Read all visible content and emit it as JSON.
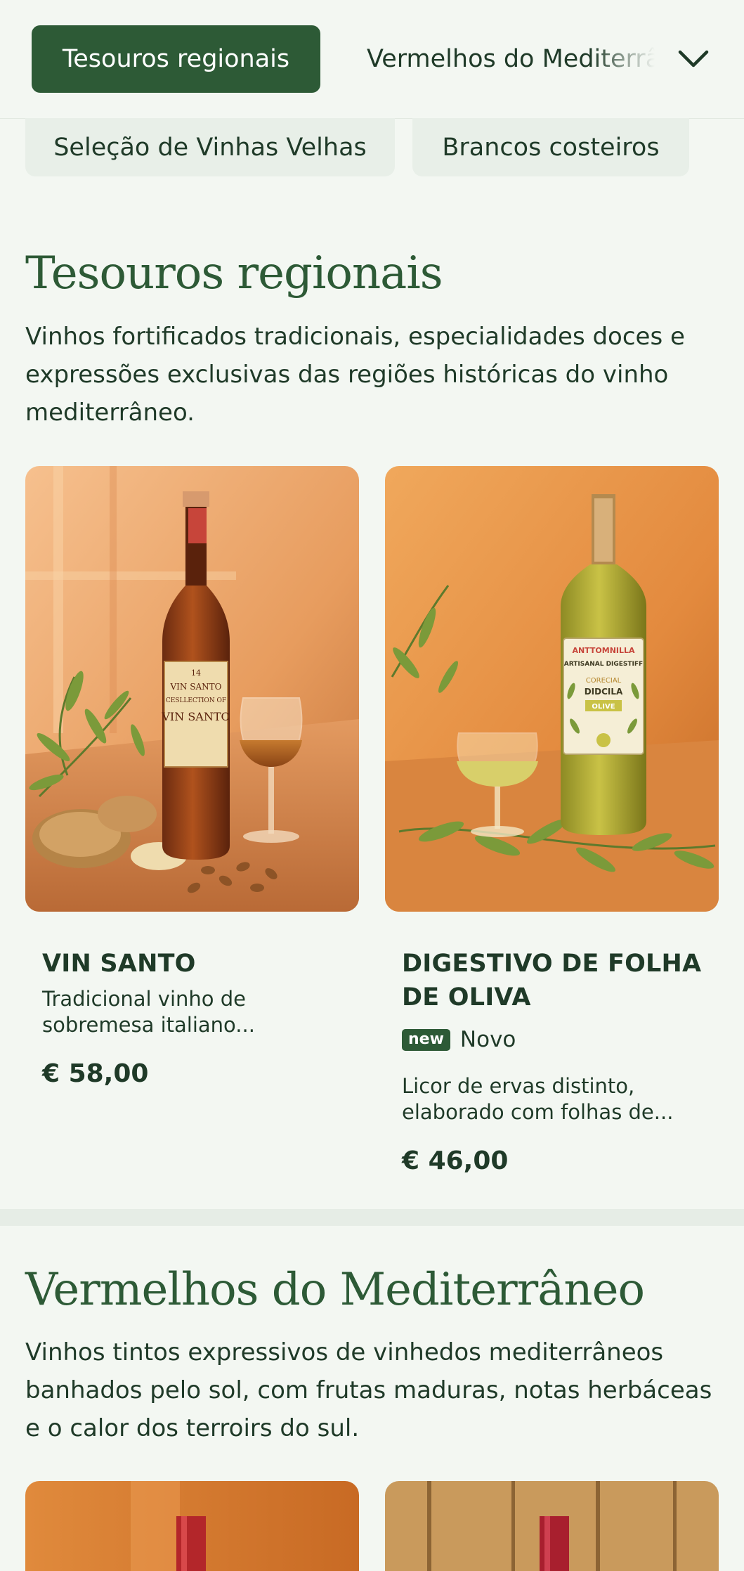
{
  "nav": {
    "active_tab": "Tesouros regionais",
    "next_tab": "Vermelhos do Mediterrâneo",
    "chevron_icon": "chevron-down-icon",
    "sub_tabs": [
      "Seleção de Vinhas Velhas",
      "Brancos costeiros"
    ]
  },
  "sections": [
    {
      "title": "Tesouros regionais",
      "description": "Vinhos fortificados tradicionais, especialidades doces e expressões exclusivas das regiões históricas do vinho mediterrâneo.",
      "products": [
        {
          "name": "VIN SANTO",
          "subtitle": "Tradicional vinho de sobremesa italiano...",
          "price": "€ 58,00",
          "label_lines": [
            "14",
            "VIN SANTO",
            "CESLLECTION OF",
            "VIN SANTO"
          ]
        },
        {
          "name": "DIGESTIVO DE FOLHA DE OLIVA",
          "badge": "new",
          "badge_label": "Novo",
          "subtitle": "Licor de ervas distinto, elaborado com folhas de...",
          "price": "€ 46,00",
          "label_lines": [
            "ANTTOMNILLA",
            "ARTISANAL DIGESTIFF",
            "CORECIAL",
            "DIDCILA",
            "OLIVE"
          ]
        }
      ]
    },
    {
      "title": "Vermelhos do Mediterrâneo",
      "description": "Vinhos tintos expressivos de vinhedos mediterrâneos banhados pelo sol, com frutas maduras, notas herbáceas e o calor dos terroirs do sul."
    }
  ],
  "colors": {
    "primary": "#2d5a36",
    "background": "#f3f7f2",
    "chip_bg": "#e8efe8"
  }
}
